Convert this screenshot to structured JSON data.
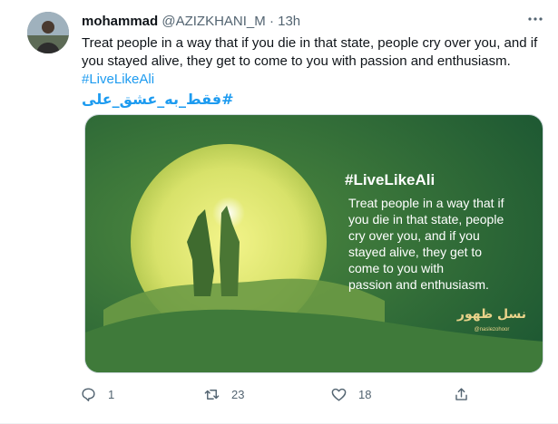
{
  "tweet": {
    "author_name": "mohammad",
    "author_handle": "@AZIZKHANI_M",
    "separator": "·",
    "time": "13h",
    "more_icon": "more-icon",
    "text": "Treat people in a way that if you die in that state, people cry over you, and if you stayed alive, they get to come to you with passion and enthusiasm.",
    "hashtag_en": "#LiveLikeAli",
    "hashtag_ar": "#فقط_به_عشق_علی",
    "media": {
      "hashtag": "#LiveLikeAli",
      "quote_lines": [
        "Treat people in a way that if",
        "you die in that state, people",
        "cry over you, and if you",
        "stayed alive, they get to",
        "come to you with",
        "passion and enthusiasm."
      ],
      "logo_text": "نسل ظهور",
      "logo_handle": "@naslezohoor",
      "colors": {
        "bg": "#2f6b3a",
        "sun": "#dfe86a",
        "text": "#ffffff"
      }
    },
    "actions": {
      "reply": {
        "icon": "reply-icon",
        "count": "1"
      },
      "retweet": {
        "icon": "retweet-icon",
        "count": "23"
      },
      "like": {
        "icon": "heart-icon",
        "count": "18"
      },
      "share": {
        "icon": "share-icon"
      }
    }
  }
}
